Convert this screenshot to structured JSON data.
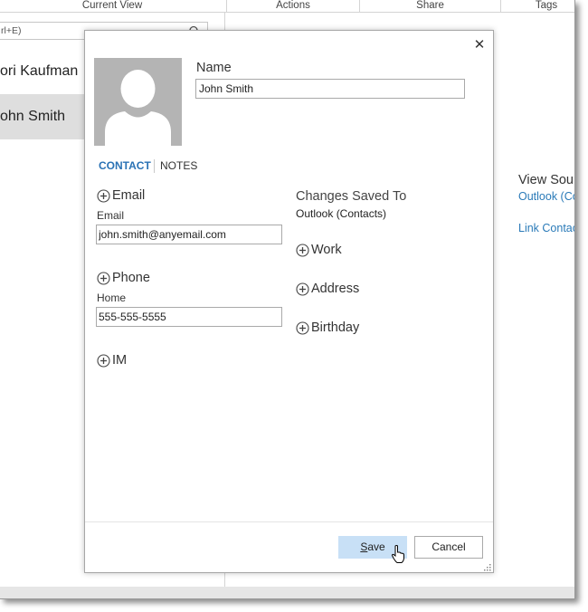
{
  "ribbon": {
    "groups": [
      "Current View",
      "Actions",
      "Share",
      "Tags"
    ]
  },
  "search": {
    "placeholder": "rl+E)"
  },
  "contacts": [
    {
      "name": "ori Kaufman"
    },
    {
      "name": "ohn Smith"
    }
  ],
  "reading_pane": {
    "view_source": "View Sou",
    "outlook_link": "Outlook (Co",
    "link_contacts": "Link Contac"
  },
  "dialog": {
    "name_label": "Name",
    "name_value": "John Smith",
    "tabs": {
      "contact": "CONTACT",
      "notes": "NOTES"
    },
    "email": {
      "header": "Email",
      "sublabel": "Email",
      "value": "john.smith@anyemail.com"
    },
    "phone": {
      "header": "Phone",
      "sublabel": "Home",
      "value": "555-555-5555"
    },
    "im": {
      "header": "IM"
    },
    "saved_to": {
      "label": "Changes Saved To",
      "value": "Outlook (Contacts)"
    },
    "right_fields": [
      "Work",
      "Address",
      "Birthday"
    ],
    "save_label_rest": "ave",
    "save_label_underlined": "S",
    "cancel_label": "Cancel",
    "close_glyph": "✕"
  },
  "colors": {
    "accent": "#2a72b5",
    "save_button_bg": "#c8e0f6",
    "photo_bg": "#b4b4b4",
    "selected_contact_bg": "#dedede"
  }
}
